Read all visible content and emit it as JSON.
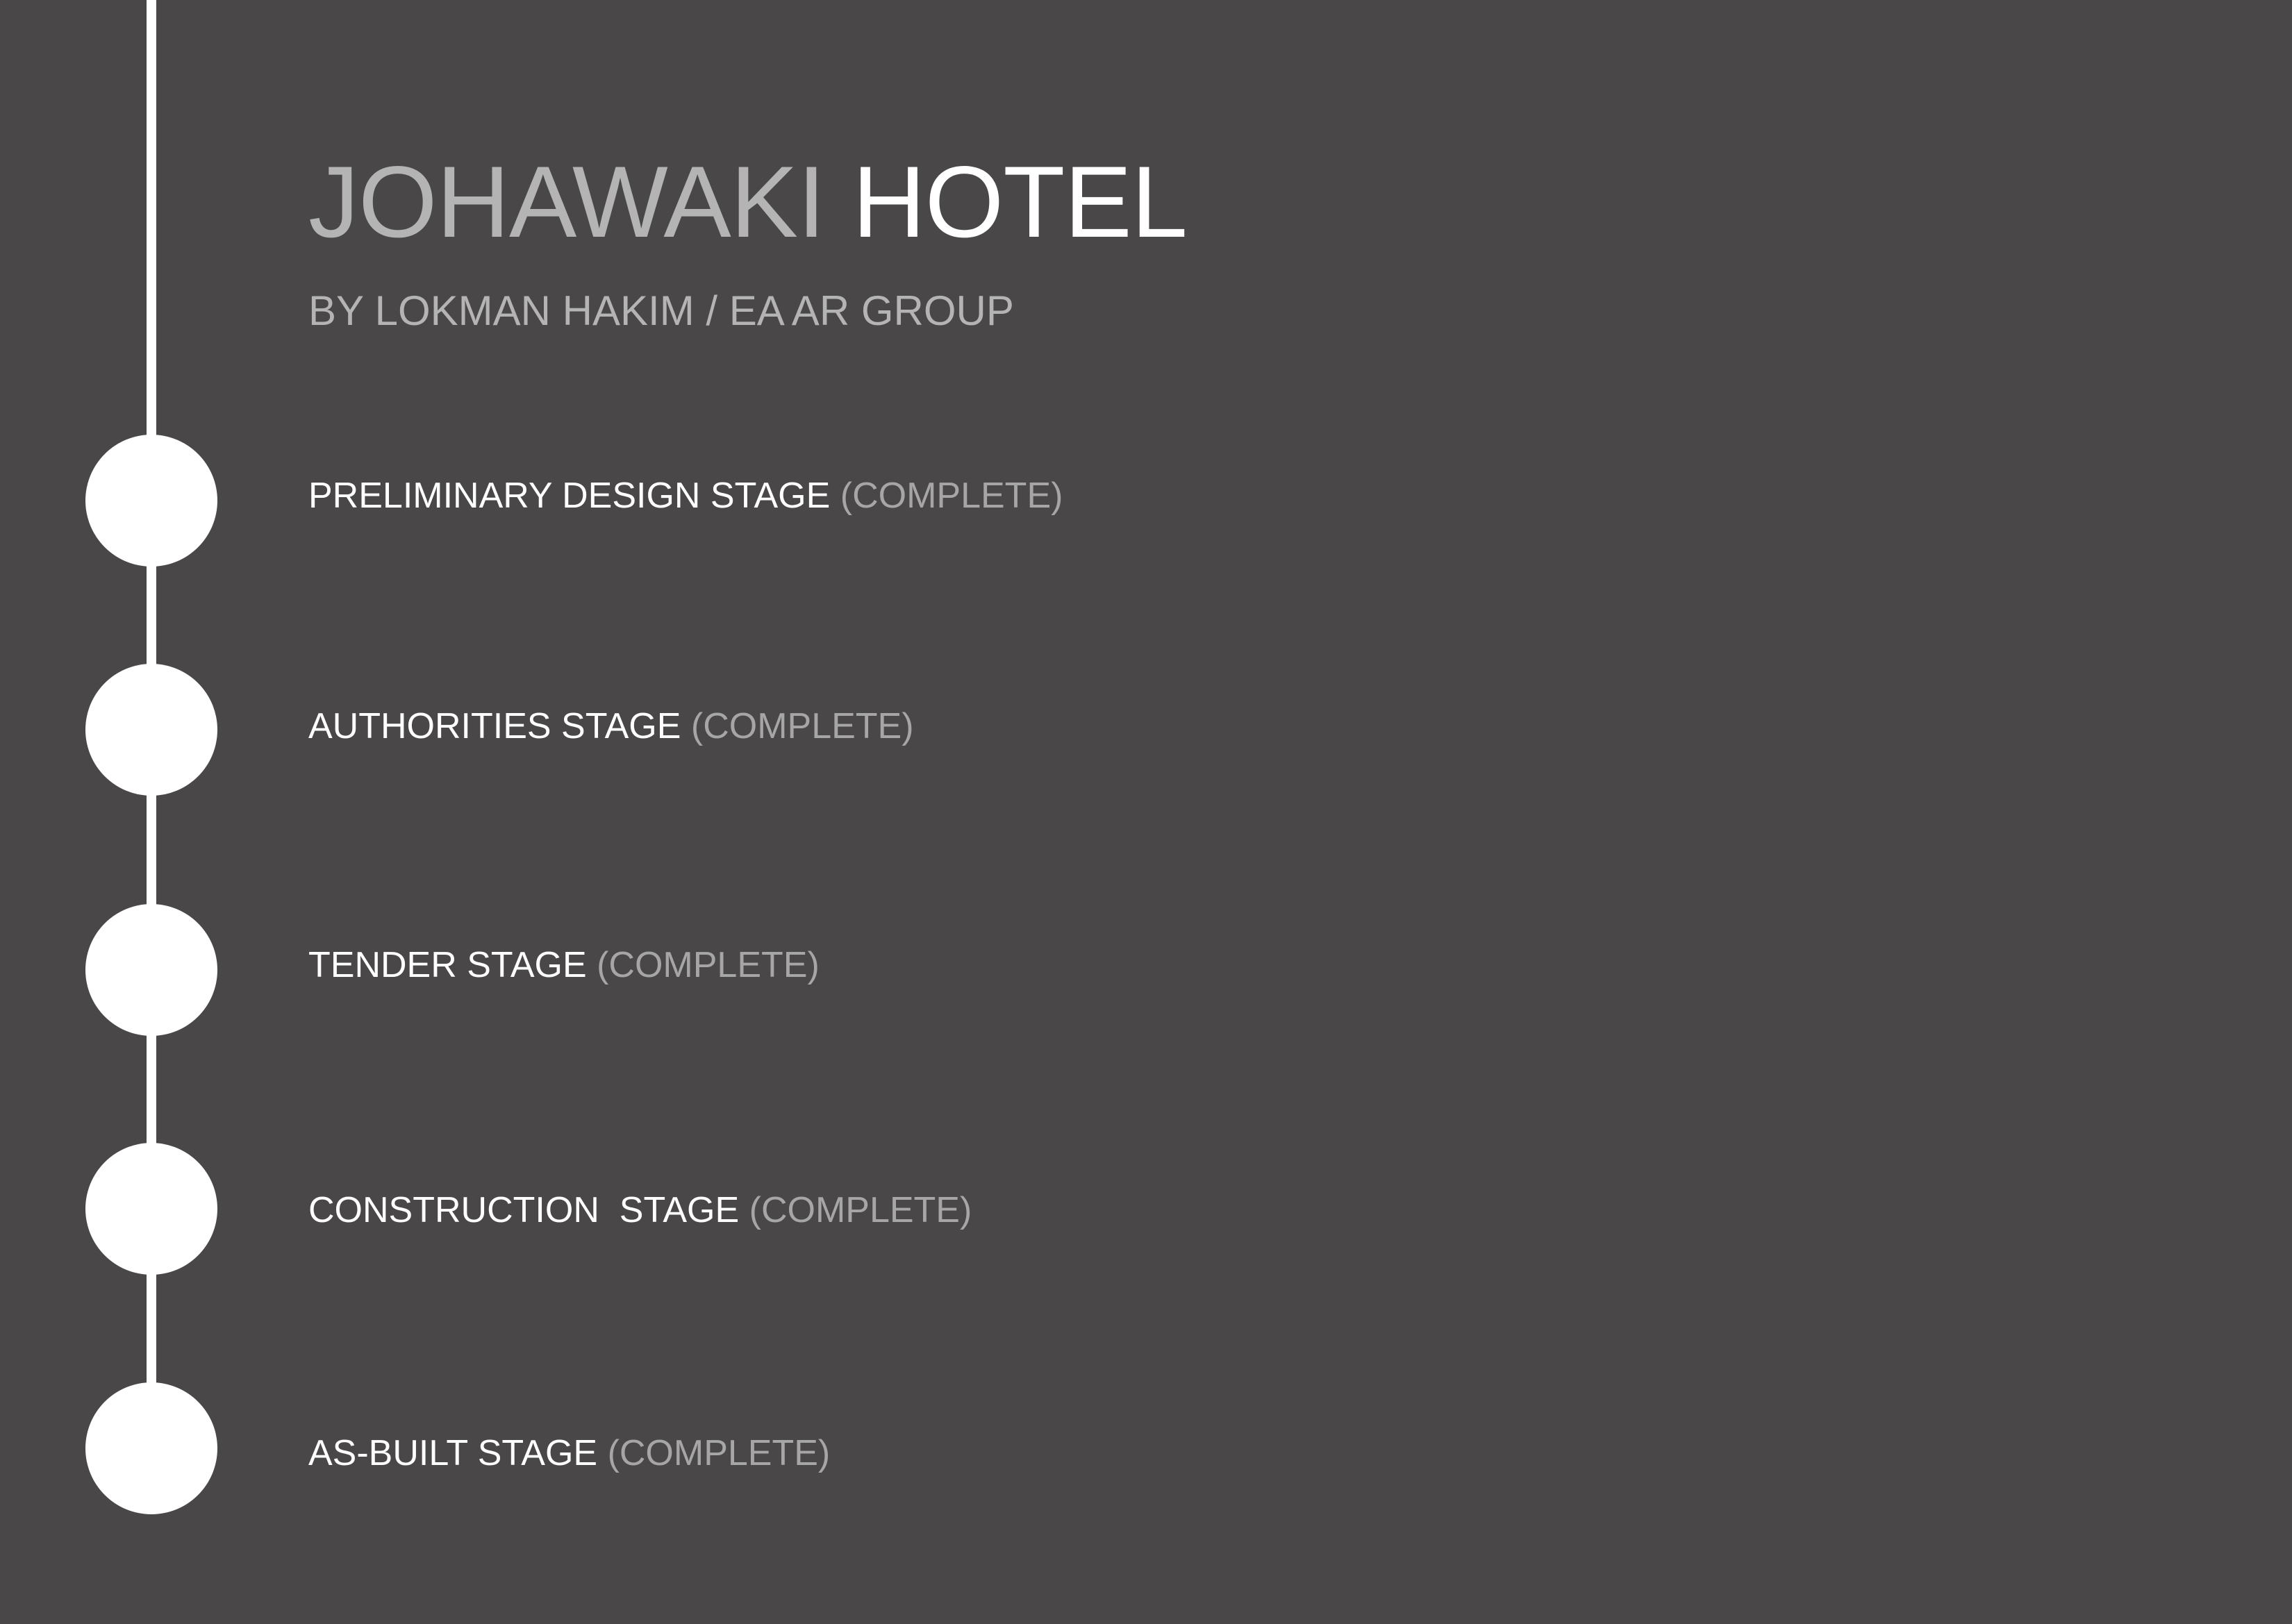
{
  "header": {
    "title_part_1": "JOHAWAKI ",
    "title_part_2": "HOTEL",
    "subtitle": "BY LOKMAN HAKIM / EA AR GROUP"
  },
  "stages": [
    {
      "name": "PRELIMINARY DESIGN STAGE ",
      "status": "(COMPLETE)"
    },
    {
      "name": "AUTHORITIES STAGE ",
      "status": "(COMPLETE)"
    },
    {
      "name": "TENDER STAGE ",
      "status": "(COMPLETE)"
    },
    {
      "name": "CONSTRUCTION  STAGE ",
      "status": "(COMPLETE)"
    },
    {
      "name": "AS-BUILT STAGE ",
      "status": "(COMPLETE)"
    }
  ],
  "colors": {
    "background": "#4a4748",
    "line": "#ffffff",
    "title_light": "#b4b4b4",
    "title_bright": "#ffffff",
    "status": "#a6a6a6"
  }
}
